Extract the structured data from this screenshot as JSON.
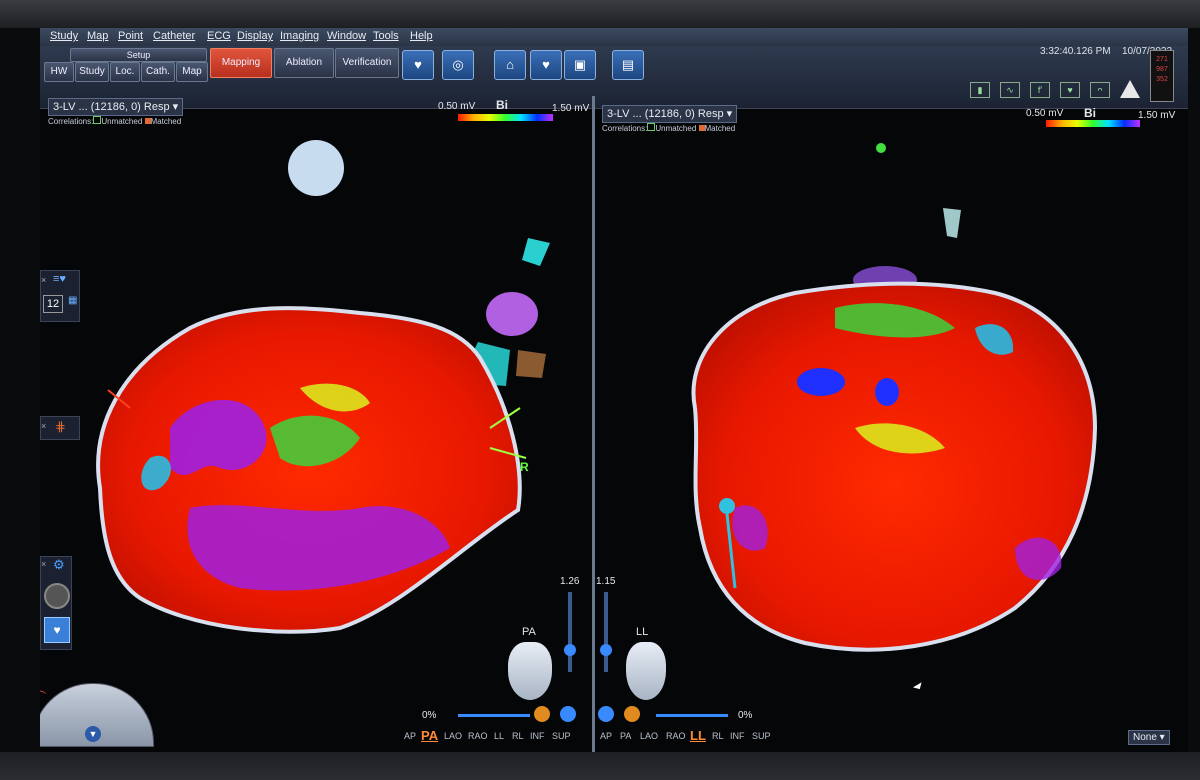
{
  "menu": [
    "Study",
    "Map",
    "Point",
    "Catheter",
    "ECG",
    "Display",
    "Imaging",
    "Window",
    "Tools",
    "Help"
  ],
  "setup": {
    "label": "Setup",
    "buttons": [
      "HW",
      "Study",
      "Loc.",
      "Cath.",
      "Map"
    ]
  },
  "modes": {
    "mapping": "Mapping",
    "ablation": "Ablation",
    "verification": "Verification"
  },
  "clock": {
    "time": "3:32:40.126 PM",
    "date": "10/07/2022"
  },
  "status_values": [
    "271",
    "987",
    "352"
  ],
  "left_map": {
    "title": "3-LV ... (12186, 0) Resp",
    "correlations": "Correlations:",
    "unmatched": "Unmatched",
    "matched": "Matched",
    "scale_min": "0.50 mV",
    "scale_type": "Bi",
    "scale_max": "1.50 mV",
    "panel_number": "12",
    "orientation": "PA",
    "marker": "R",
    "zoom": "1.26",
    "rotation": "0%",
    "views": [
      "AP",
      "PA",
      "LAO",
      "RAO",
      "LL",
      "RL",
      "INF",
      "SUP"
    ],
    "selected_view": "PA"
  },
  "right_map": {
    "title": "3-LV ... (12186, 0) Resp",
    "correlations": "Correlations:",
    "unmatched": "Unmatched",
    "matched": "Matched",
    "scale_min": "0.50 mV",
    "scale_type": "Bi",
    "scale_max": "1.50 mV",
    "orientation": "LL",
    "zoom": "1.15",
    "rotation": "0%",
    "views": [
      "AP",
      "PA",
      "LAO",
      "RAO",
      "LL",
      "RL",
      "INF",
      "SUP"
    ],
    "selected_view": "LL",
    "dropdown": "None"
  },
  "colors": {
    "accent": "#e0553c",
    "panel": "#2a3446",
    "scale_red": "#ff1a00",
    "scale_purple": "#c030ff"
  }
}
